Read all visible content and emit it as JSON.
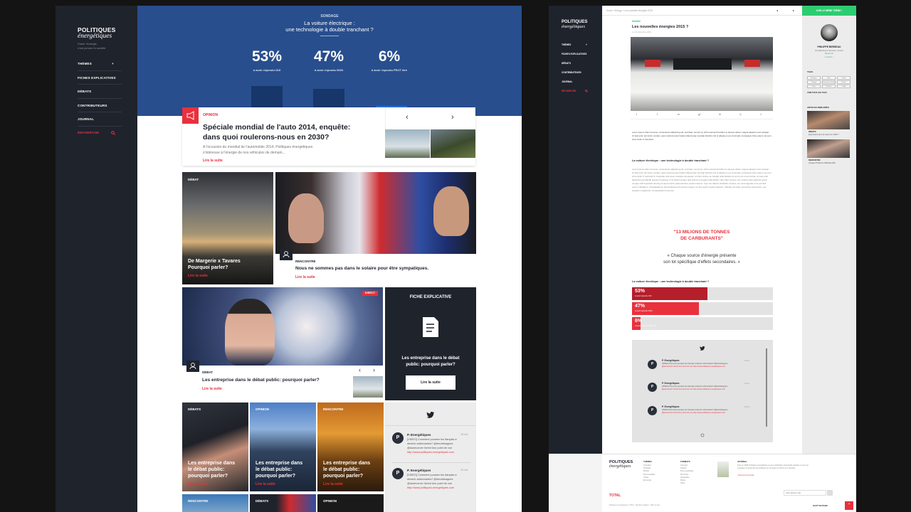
{
  "left_page": {
    "logo": {
      "line1": "POLITIQUES",
      "line2": "énergétiques"
    },
    "tagline": {
      "line1": "Parler l'énergie,",
      "line2": "c'est penser le société"
    },
    "nav": [
      {
        "label": "THÈMES",
        "arrow": "+"
      },
      {
        "label": "FICHES EXPLICATIVES"
      },
      {
        "label": "DÉBATS"
      },
      {
        "label": "CONTRIBUTEURS"
      },
      {
        "label": "JOURNAL"
      },
      {
        "label": "RECHERCHE"
      }
    ],
    "survey": {
      "label": "SONDAGE",
      "q1": "La voiture électrique :",
      "q2": "une technologie à double tranchant ?",
      "results": [
        {
          "pct": "53%",
          "label": "à avoir répondu OUI",
          "value": 53
        },
        {
          "pct": "47%",
          "label": "à avoir répondu NON",
          "value": 47
        },
        {
          "pct": "6%",
          "label": "à avoir répondu PEUT être",
          "value": 6
        }
      ]
    },
    "feature": {
      "kicker": "OPINION",
      "title1": "Spéciale mondial de l'auto 2014, enquête:",
      "title2": "dans quoi roulerons-nous en 2030?",
      "text1": "A l'occasion du mondial de l'automobile 2014, Politiques énergétiques",
      "text2": "s'intéresse à l'énergie de nos véhicules de demain...",
      "more": "Lire la suite",
      "prev": "‹",
      "next": "›"
    },
    "tile_debat": {
      "kicker": "DÉBAT",
      "title1": "De Margerie x Tavares",
      "title2": "Pourquoi parler?",
      "more": "Lire la suite"
    },
    "tile_rencontre": {
      "kicker": "RENCONTRE",
      "title": "Nous ne sommes pas dans le solaire pour être sympatiques.",
      "more": "Lire la suite"
    },
    "tile_debat2": {
      "badge": "DIRECT",
      "kicker": "DÉBAT",
      "title": "Les entreprise dans le débat public: pourquoi parler?",
      "more": "Lire la suite",
      "prev": "‹",
      "next": "›"
    },
    "fiche": {
      "label": "FICHE EXPLICATIVE",
      "text1": "Les entreprise dans le débat",
      "text2": "public: pourquoi parler?",
      "button": "Lire la suite"
    },
    "small_tiles": [
      {
        "kicker": "DÉBATS",
        "t1": "Les entreprise dans",
        "t2": "le débat public:",
        "t3": "pourquoi parler?",
        "more": "Lire la suite"
      },
      {
        "kicker": "OPINION",
        "t1": "Les entreprise dans",
        "t2": "le débat public:",
        "t3": "pourquoi parler?",
        "more": "Lire la suite"
      },
      {
        "kicker": "RENCONTRE",
        "t1": "Les entreprise dans",
        "t2": "le débat public:",
        "t3": "pourquoi parler?",
        "more": "Lire la suite"
      }
    ],
    "bottom_kickers": [
      "RENCONTRE",
      "DÉBATS",
      "OPINION"
    ],
    "tweets": [
      {
        "name": "P. Energétiques",
        "time": "19 oct",
        "l1": "[VIDEO] Comment pousser les français à",
        "l2": "devenir actionnaires? @berceilsagues",
        "l3": "@laurecorver livrent leur point de vue",
        "l4": "http://www.politiques-energetiques.com"
      },
      {
        "name": "P. Energétiques",
        "time": "19 oct",
        "l1": "[VIDEO] Comment pousser les français à",
        "l2": "devenir actionnaires? @berceilsagues",
        "l3": "@laurecorver livrent leur point de vue",
        "l4": "http://www.politiques-energetiques.com"
      }
    ]
  },
  "right_page": {
    "topbar": {
      "crumb1": "Home",
      "crumb2": "Energy",
      "crumb3": "Les nouvelles énergies 2015",
      "cta": "JOIN LE MÊME THÈME  ›"
    },
    "logo": {
      "line1": "POLITIQUES",
      "line2": "énergétiques"
    },
    "nav": [
      {
        "label": "THÈMES",
        "arrow": "+"
      },
      {
        "label": "FICHES EXPLICATIVES"
      },
      {
        "label": "DÉBATS"
      },
      {
        "label": "CONTRIBUTEURS"
      },
      {
        "label": "JOURNAL"
      },
      {
        "label": "RECHERCHE"
      }
    ],
    "article": {
      "kicker": "Mobilité",
      "title": "Les nouvelles énergies 2015 ?",
      "date": "Le 18 décembre 2014",
      "share": [
        "t",
        "f",
        "in",
        "g+",
        "✉",
        "⎙",
        "«"
      ],
      "p1": "Lorem ipsum dolor sit amet, consectetur adipiscing elit, sed diam nonummy nibh euismod tincidunt ut laoreet dolore magna aliquam erat volutpat. Ut wisi enim ad minim veniam, quis nostrud exerci tation ullamcorper suscipit lobortis nisl ut aliquip ex ea commodo consequat. Duis autem vel eum iriure dolor in hendrerit.",
      "h2": "La voiture électrique : une technologie à double tranchant ?",
      "p2": "Lorem ipsum dolor sit amet, consectetur adipiscing elit, sed diam nonummy nibh euismod tincidunt ut laoreet dolore magna aliquam erat volutpat. Ut wisi enim ad minim veniam, quis nostrud exerci tation ullamcorper suscipit lobortis nisl ut aliquip ex ea commodo consequat. Duis autem vel eum iriure dolor in hendrerit in vulputate velit esse molestie consequat, vel illum dolore eu feugiat nulla facilisis at vero eros et accumsan et iusto odio dignissim qui blandit praesent luptatum zzril delenit augue duis dolore te feugait nulla facilisi. Nam liber tempor cum soluta nobis eleifend option congue nihil imperdiet doming id quod mazim placerat facer possim assum. Typi non habent claritatem insitam; est usus legentis in iis qui facit eorum claritatem. Investigationes demonstraverunt lectores legere me lius quod ii legunt saepius. Claritas est etiam processus dynamicus, qui sequitur mutationem consuetudium lectorum.",
      "quote1": "\"13 MILIONS DE TONNES",
      "quote2": "DE CARBURANTS\"",
      "q2a": "« Chaque source d'énergie présente",
      "q2b": "son lot spécifique d'effets secondaires. »",
      "poll_title": "La voiture électrique : une technologie à double tranchant ?",
      "poll": [
        {
          "pct": "53%",
          "label": "à avoir répondu OUI",
          "value": 53,
          "color": "#b51e2b"
        },
        {
          "pct": "47%",
          "label": "à avoir répondu NON",
          "value": 47,
          "color": "#e8313d"
        },
        {
          "pct": "6%",
          "label": "à avoir répondu PEUT être",
          "value": 6,
          "color": "#e8313d"
        }
      ]
    },
    "tweets": [
      {
        "name": "P. Energétiques",
        "time": "19 oct",
        "l1": "[VIDEO] Comment pousser les français à devenir actionnaires? @berceilsagues",
        "l2": "@laurecorver livrent leur point de vue http://www.politiques-energetiques.com"
      },
      {
        "name": "P. Energétiques",
        "time": "19 oct",
        "l1": "[VIDEO] Comment pousser les français à devenir actionnaires? @berceilsagues",
        "l2": "@laurecorver livrent leur point de vue http://www.politiques-energetiques.com"
      },
      {
        "name": "P. Energétiques",
        "time": "19 oct",
        "l1": "[VIDEO] Comment pousser les français à devenir actionnaires? @berceilsagues",
        "l2": "@laurecorver livrent leur point de vue http://www.politiques-energetiques.com"
      }
    ],
    "author": {
      "name": "PHILIPPE BERSEAU",
      "role": "DG Marketing & Services, Lorraine",
      "org": "Nu Lon Gr",
      "link": "3 articles »"
    },
    "tags_label": "TAGS",
    "tags": [
      "Energies",
      "Auto",
      "Climat",
      "Charges",
      "Transition énergétique",
      "Voiture",
      "Débat",
      "Mondial",
      "Lobby"
    ],
    "tags_more": "VOIR TOUS LES TAGS",
    "similar_label": "ARTICLES SIMILAIRES",
    "similar": [
      {
        "kicker": "DÉBATS",
        "title": "Quel avenir pour la voiture en 2030 ?"
      },
      {
        "kicker": "RENCONTRE",
        "title": "Jacques D'Affroux d'ENGIE-GDF"
      }
    ],
    "footer": {
      "col1_title": "THÈMES",
      "col1": [
        "Transition",
        "Nucléaire",
        "Pétrole",
        "Renouvelables",
        "Climat",
        "Économie"
      ],
      "col2_title": "FORMATS",
      "col2": [
        "Interview",
        "Opinion",
        "Fiche explicative",
        "Rencontre",
        "Infographie",
        "Débat",
        "Vidéo"
      ],
      "col3_title": "JOURNAL",
      "col3": "Créé en 2008, Politiques énergétiques est une publication trimestrielle destinée à ceux qui souhaitent comprendre les politiques de l'énergie en France et en Europe.",
      "col3_more": "› Découvrir le journal",
      "newsletter_placeholder": "Votre adresse mail",
      "legal": "Politiques énergétiques © 2014 · Mentions légales · Plan du site",
      "brand": "TOTAL",
      "up": "⌃",
      "backtop": "HAUT DE PAGE"
    }
  }
}
